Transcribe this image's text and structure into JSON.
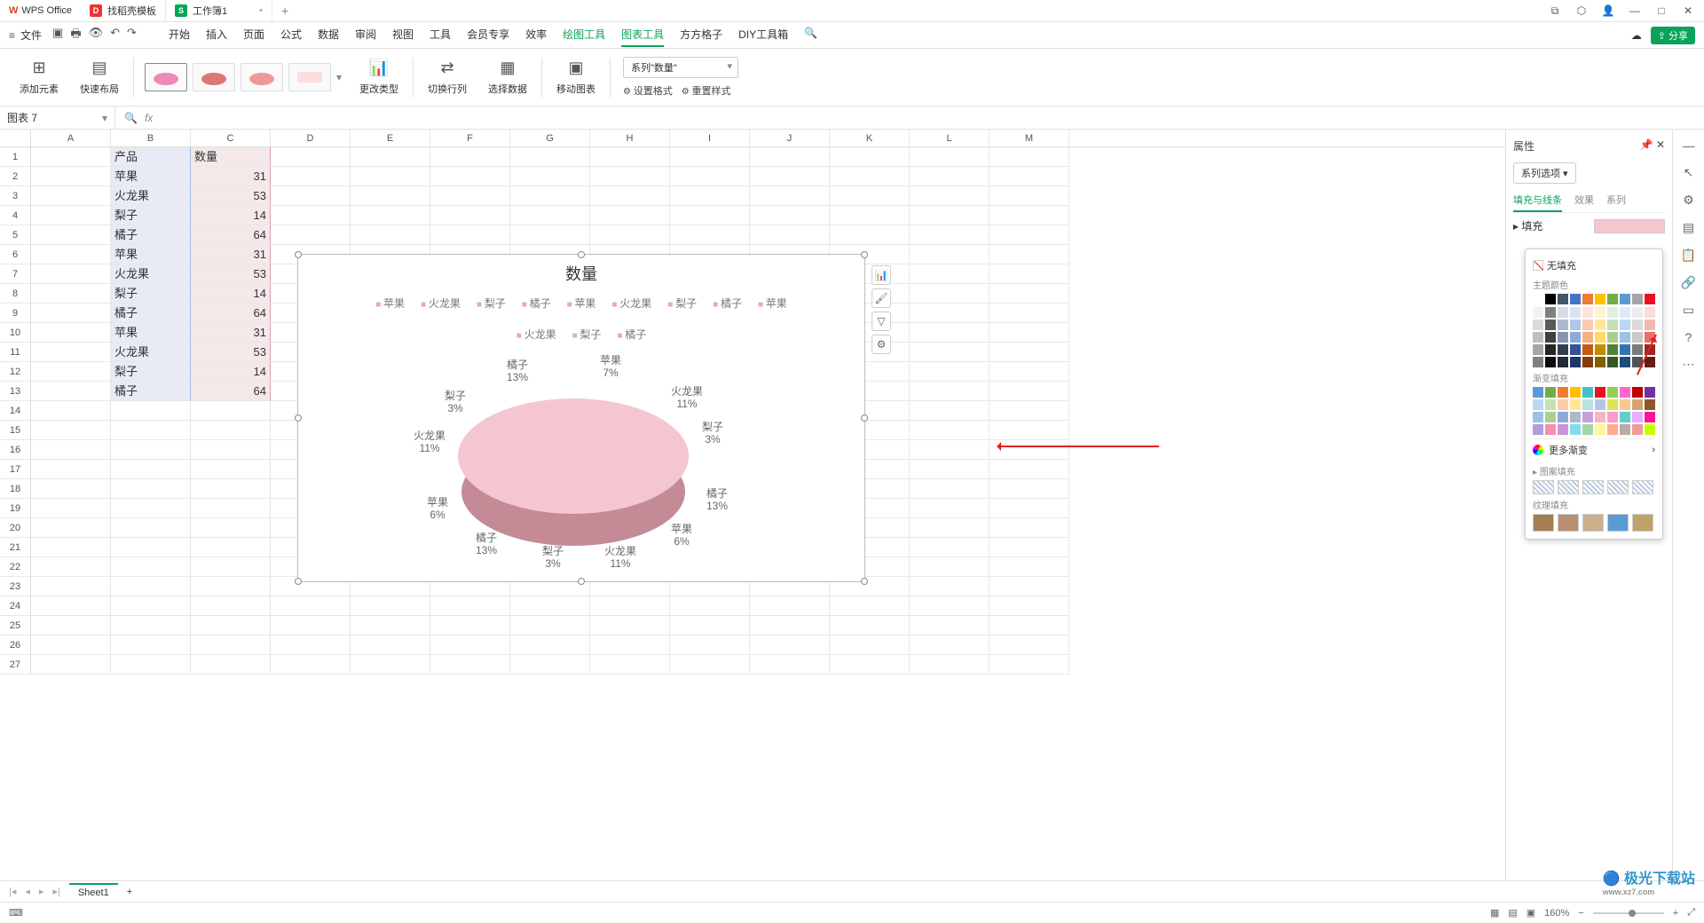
{
  "titlebar": {
    "app": "WPS Office",
    "tab_template": "找稻壳模板",
    "tab_workbook": "工作簿1"
  },
  "menu": {
    "file": "文件",
    "tabs": [
      "开始",
      "插入",
      "页面",
      "公式",
      "数据",
      "审阅",
      "视图",
      "工具",
      "会员专享",
      "效率",
      "绘图工具",
      "图表工具",
      "方方格子",
      "DIY工具箱"
    ],
    "share": "分享"
  },
  "ribbon": {
    "add_element": "添加元素",
    "quick_layout": "快速布局",
    "change_type": "更改类型",
    "switch_rc": "切换行列",
    "select_data": "选择数据",
    "move_chart": "移动图表",
    "series_select": "系列\"数量\"",
    "set_format": "设置格式",
    "reset_style": "重置样式"
  },
  "namebox": "图表 7",
  "columns": [
    "A",
    "B",
    "C",
    "D",
    "E",
    "F",
    "G",
    "H",
    "I",
    "J",
    "K",
    "L",
    "M"
  ],
  "table": {
    "h1": "产品",
    "h2": "数量",
    "rows": [
      [
        "苹果",
        "31"
      ],
      [
        "火龙果",
        "53"
      ],
      [
        "梨子",
        "14"
      ],
      [
        "橘子",
        "64"
      ],
      [
        "苹果",
        "31"
      ],
      [
        "火龙果",
        "53"
      ],
      [
        "梨子",
        "14"
      ],
      [
        "橘子",
        "64"
      ],
      [
        "苹果",
        "31"
      ],
      [
        "火龙果",
        "53"
      ],
      [
        "梨子",
        "14"
      ],
      [
        "橘子",
        "64"
      ]
    ]
  },
  "chart": {
    "title": "数量"
  },
  "chart_data": {
    "type": "pie",
    "title": "数量",
    "categories": [
      "苹果",
      "火龙果",
      "梨子",
      "橘子",
      "苹果",
      "火龙果",
      "梨子",
      "橘子",
      "苹果",
      "火龙果",
      "梨子",
      "橘子"
    ],
    "values": [
      31,
      53,
      14,
      64,
      31,
      53,
      14,
      64,
      31,
      53,
      14,
      64
    ],
    "labels": [
      {
        "name": "苹果",
        "pct": "7%"
      },
      {
        "name": "火龙果",
        "pct": "11%"
      },
      {
        "name": "梨子",
        "pct": "3%"
      },
      {
        "name": "橘子",
        "pct": "13%"
      },
      {
        "name": "苹果",
        "pct": "6%"
      },
      {
        "name": "火龙果",
        "pct": "11%"
      },
      {
        "name": "梨子",
        "pct": "3%"
      },
      {
        "name": "橘子",
        "pct": "13%"
      },
      {
        "name": "苹果",
        "pct": "6%"
      },
      {
        "name": "火龙果",
        "pct": "11%"
      },
      {
        "name": "梨子",
        "pct": "3%"
      },
      {
        "name": "橘子",
        "pct": "13%"
      }
    ]
  },
  "panel": {
    "title": "属性",
    "series_opt": "系列选项",
    "tab_fill": "填充与线条",
    "tab_effect": "效果",
    "tab_series": "系列",
    "fill": "填充",
    "no_fill": "无填充",
    "theme_colors": "主题颜色",
    "gradient": "渐变填充",
    "more_gradient": "更多渐变",
    "pattern": "图案填充",
    "texture": "纹理填充"
  },
  "theme_colors_row1": [
    "#ffffff",
    "#000000",
    "#44546a",
    "#4472c4",
    "#ed7d31",
    "#ffc000",
    "#70ad47",
    "#5b9bd5",
    "#a5a5a5",
    "#e81123"
  ],
  "theme_tints": [
    [
      "#f2f2f2",
      "#808080",
      "#d6dce5",
      "#d9e1f2",
      "#fce4d6",
      "#fff2cc",
      "#e2efda",
      "#ddebf7",
      "#ededed",
      "#fadbd8"
    ],
    [
      "#d9d9d9",
      "#595959",
      "#acb9ca",
      "#b4c6e7",
      "#f8cbad",
      "#ffe699",
      "#c6e0b4",
      "#bdd7ee",
      "#dbdbdb",
      "#f5b7b1"
    ],
    [
      "#bfbfbf",
      "#404040",
      "#8497b0",
      "#8ea9db",
      "#f4b084",
      "#ffd966",
      "#a9d08e",
      "#9bc2e6",
      "#c9c9c9",
      "#ec7063"
    ],
    [
      "#a6a6a6",
      "#262626",
      "#333f4f",
      "#305496",
      "#c65911",
      "#bf8f00",
      "#548235",
      "#2f75b5",
      "#7b7b7b",
      "#922b21"
    ],
    [
      "#808080",
      "#0d0d0d",
      "#222b35",
      "#203764",
      "#833c0c",
      "#806000",
      "#375623",
      "#1f4e78",
      "#525252",
      "#641e16"
    ]
  ],
  "gradient_colors": [
    [
      "#5b9bd5",
      "#70ad47",
      "#ed7d31",
      "#ffc000",
      "#44c1c4",
      "#e81123",
      "#92d050",
      "#ff66cc",
      "#c00000",
      "#7030a0"
    ],
    [
      "#bdd7ee",
      "#c6e0b4",
      "#f8cbad",
      "#ffe699",
      "#b7e1e4",
      "#b4c6e7",
      "#dde455",
      "#fbc98e",
      "#d4a373",
      "#8b5a2b"
    ],
    [
      "#9bc2e6",
      "#a9d08e",
      "#8ea9db",
      "#acb9ca",
      "#c9a0dc",
      "#f4b6c2",
      "#ff99cc",
      "#66cccc",
      "#e0b0ff",
      "#ff1493"
    ],
    [
      "#b39ddb",
      "#f48fb1",
      "#ce93d8",
      "#80deea",
      "#a5d6a7",
      "#fff59d",
      "#ffab91",
      "#bcaaa4",
      "#ef9a9a",
      "#c6ff00"
    ]
  ],
  "textures": [
    "#a67c52",
    "#b89070",
    "#c9b18c",
    "#5b9bd5",
    "#bfa16a"
  ],
  "sheet": {
    "name": "Sheet1"
  },
  "status": {
    "zoom": "160%"
  },
  "watermark": {
    "name": "极光下载站",
    "url": "www.xz7.com"
  }
}
